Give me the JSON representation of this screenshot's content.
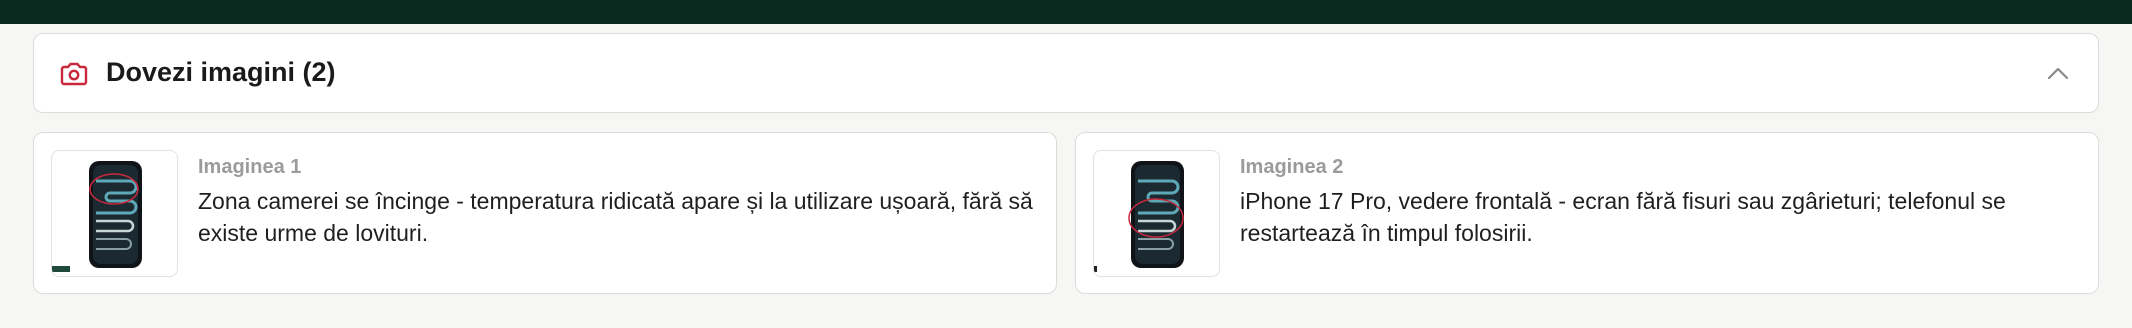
{
  "section": {
    "title": "Dovezi imagini (2)",
    "icon": "camera-icon",
    "toggle_icon": "chevron-up-icon",
    "accent_color": "#c8283c"
  },
  "images": [
    {
      "label": "Imaginea 1",
      "description": "Zona camerei se încinge - temperatura ridicată apare și la utilizare ușoară, fără să existe urme de lovituri."
    },
    {
      "label": "Imaginea 2",
      "description": "iPhone 17 Pro, vedere frontală - ecran fără fisuri sau zgârieturi; telefonul se restartează în timpul folosirii."
    }
  ]
}
